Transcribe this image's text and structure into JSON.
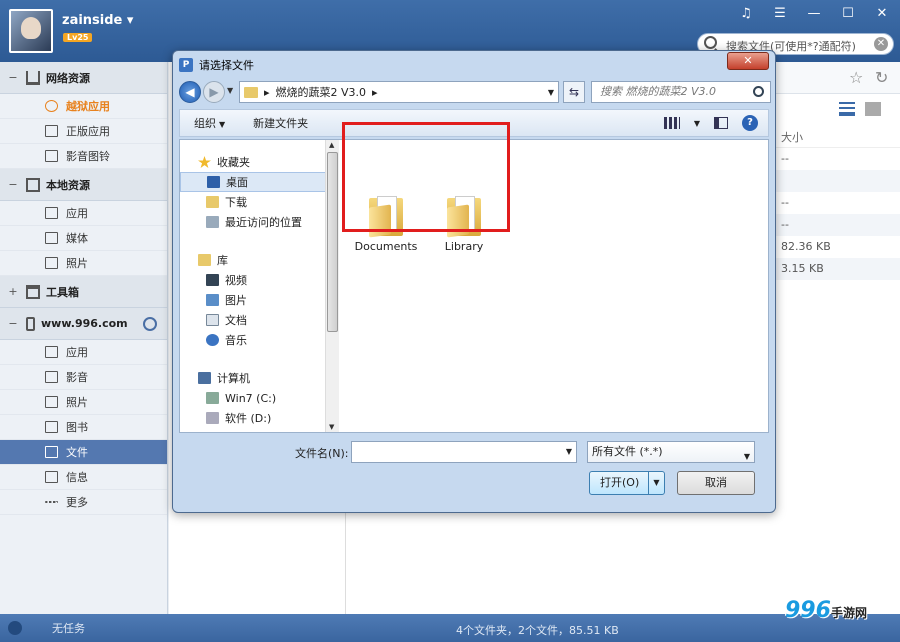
{
  "header": {
    "username": "zainside",
    "level": "Lv25",
    "search_placeholder": "搜索文件(可使用*?通配符)"
  },
  "sidebar": {
    "groups": [
      {
        "label": "网络资源",
        "toggle": "−",
        "items": [
          "越狱应用",
          "正版应用",
          "影音图铃"
        ]
      },
      {
        "label": "本地资源",
        "toggle": "−",
        "items": [
          "应用",
          "媒体",
          "照片"
        ]
      },
      {
        "label": "工具箱",
        "toggle": "+"
      },
      {
        "label": "www.996.com",
        "toggle": "−",
        "items": [
          "应用",
          "影音",
          "照片",
          "图书",
          "文件",
          "信息",
          "更多"
        ]
      }
    ]
  },
  "content": {
    "column_header": "大小",
    "right_rows": [
      "--",
      "",
      "--",
      "--",
      "82.36 KB",
      "3.15 KB"
    ]
  },
  "statusbar": {
    "left": "无任务",
    "center": "4个文件夹，2个文件，85.51 KB"
  },
  "watermark": {
    "main": "996",
    "sub": "手游网"
  },
  "dialog": {
    "title": "请选择文件",
    "close": "✕",
    "address": [
      "燃烧的蔬菜2 V3.0"
    ],
    "search_placeholder": "搜索 燃烧的蔬菜2 V3.0",
    "toolbar": {
      "organize": "组织",
      "new_folder": "新建文件夹"
    },
    "tree": {
      "favorites": "收藏夹",
      "fav_items": [
        "桌面",
        "下载",
        "最近访问的位置"
      ],
      "libraries": "库",
      "lib_items": [
        "视频",
        "图片",
        "文档",
        "音乐"
      ],
      "computer": "计算机",
      "comp_items": [
        "Win7 (C:)",
        "软件 (D:)"
      ]
    },
    "files": [
      {
        "name": "Documents"
      },
      {
        "name": "Library"
      }
    ],
    "filename_label": "文件名(N):",
    "filename_value": "",
    "filter": "所有文件 (*.*)",
    "open_button": "打开(O)",
    "cancel_button": "取消"
  }
}
